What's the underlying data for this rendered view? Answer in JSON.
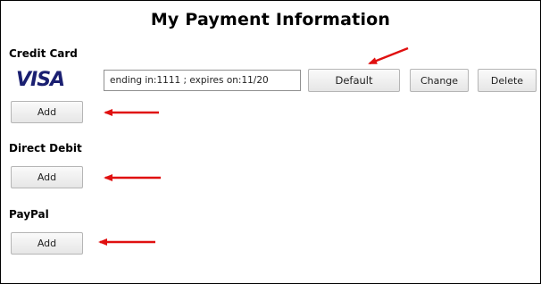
{
  "page": {
    "title": "My Payment Information"
  },
  "credit_card": {
    "label": "Credit Card",
    "brand_logo": "VISA",
    "card_summary": "ending in:1111 ; expires on:11/20",
    "default_label": "Default",
    "change_label": "Change",
    "delete_label": "Delete",
    "add_label": "Add"
  },
  "direct_debit": {
    "label": "Direct Debit",
    "add_label": "Add"
  },
  "paypal": {
    "label": "PayPal",
    "add_label": "Add"
  },
  "annotations": {
    "arrow_color": "#e01010",
    "arrow_icon": "red-pointer-arrow"
  },
  "colors": {
    "visa_blue": "#1a1f71",
    "button_border": "#b5b5b5"
  }
}
